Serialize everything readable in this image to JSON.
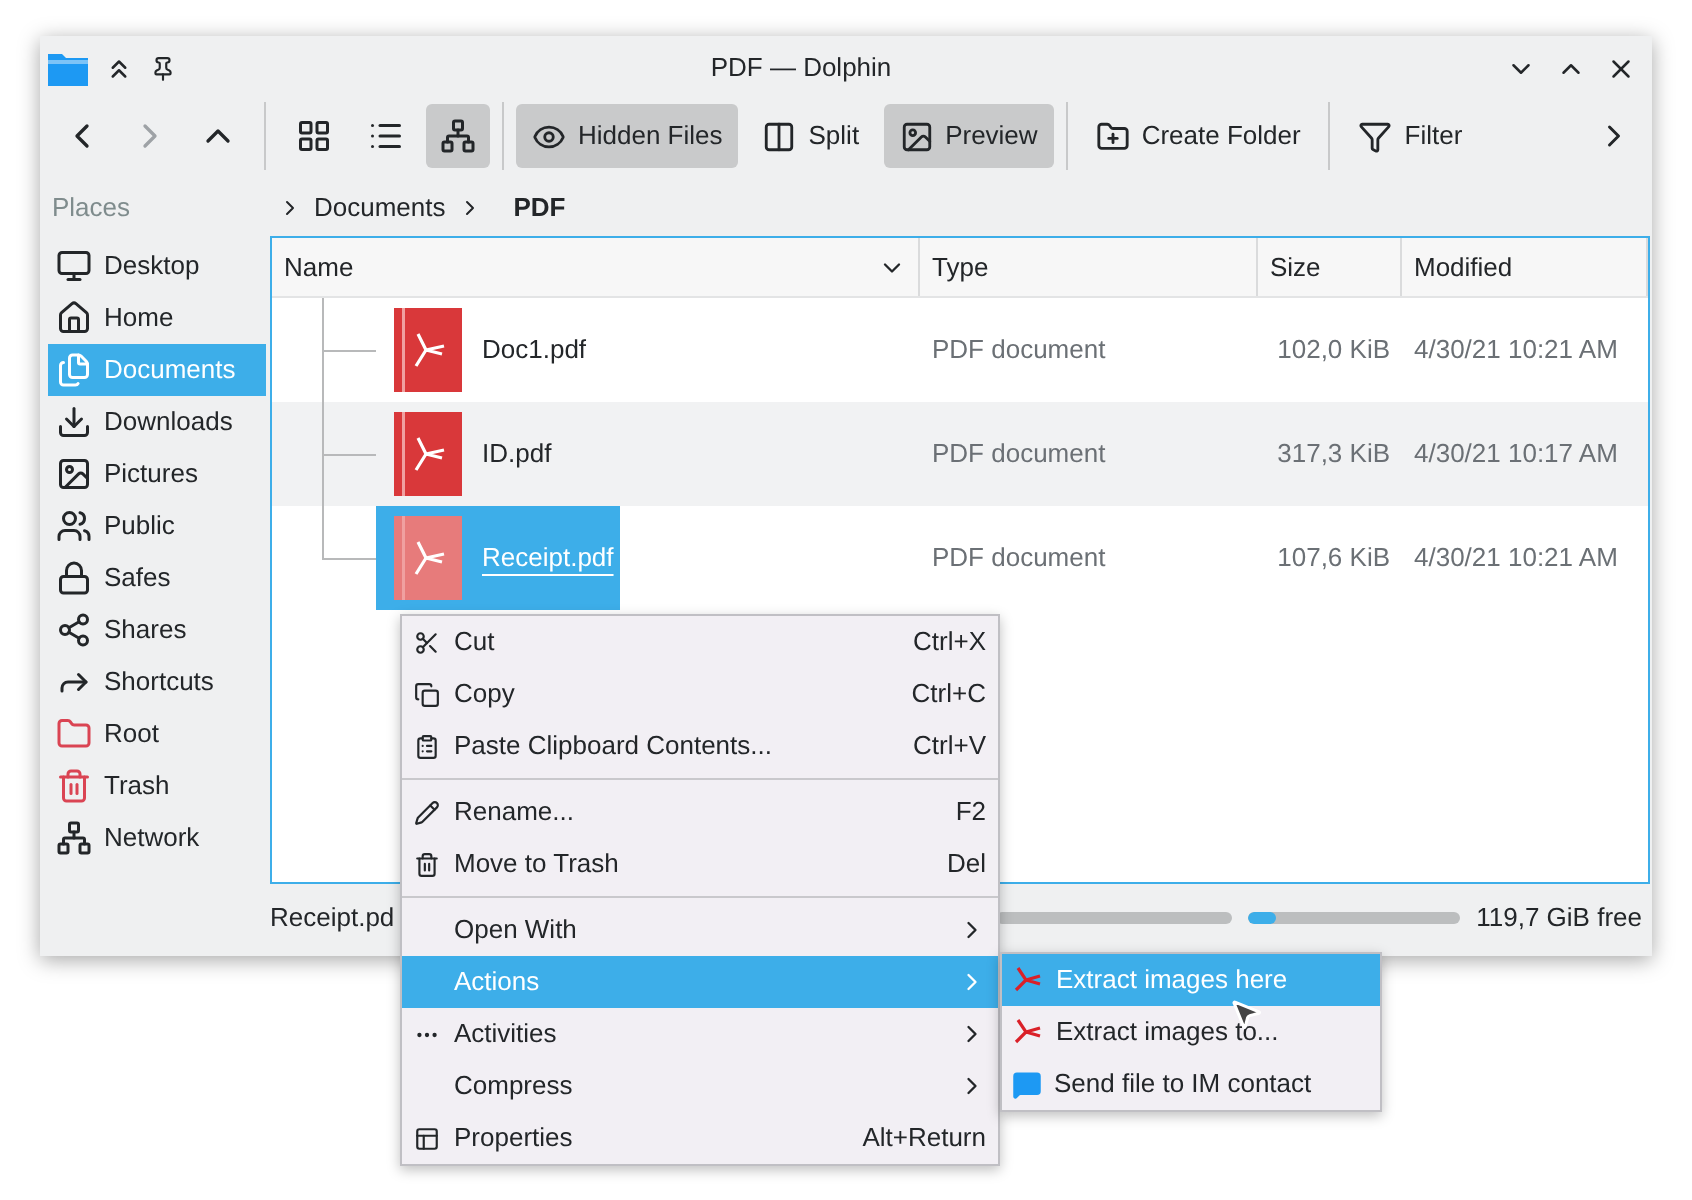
{
  "window": {
    "title": "PDF — Dolphin"
  },
  "toolbar": {
    "view_modes": [
      {
        "kind": "icons",
        "selected": false
      },
      {
        "kind": "compact",
        "selected": false
      },
      {
        "kind": "details",
        "selected": true
      }
    ],
    "buttons": [
      {
        "kind": "hidden",
        "label": "Hidden Files",
        "selected": true
      },
      {
        "kind": "split",
        "label": "Split",
        "selected": false
      },
      {
        "kind": "preview",
        "label": "Preview",
        "selected": true
      },
      {
        "kind": "create",
        "label": "Create Folder",
        "selected": false
      },
      {
        "kind": "filter",
        "label": "Filter",
        "selected": false
      }
    ]
  },
  "places": {
    "header": "Places",
    "items": [
      {
        "kind": "desktop",
        "label": "Desktop",
        "selected": false
      },
      {
        "kind": "home",
        "label": "Home",
        "selected": false
      },
      {
        "kind": "documents",
        "label": "Documents",
        "selected": true
      },
      {
        "kind": "downloads",
        "label": "Downloads",
        "selected": false
      },
      {
        "kind": "pictures",
        "label": "Pictures",
        "selected": false
      },
      {
        "kind": "public",
        "label": "Public",
        "selected": false
      },
      {
        "kind": "safes",
        "label": "Safes",
        "selected": false
      },
      {
        "kind": "shares",
        "label": "Shares",
        "selected": false
      },
      {
        "kind": "shortcuts",
        "label": "Shortcuts",
        "selected": false
      },
      {
        "kind": "root",
        "label": "Root",
        "selected": false
      },
      {
        "kind": "trash",
        "label": "Trash",
        "selected": false
      },
      {
        "kind": "network",
        "label": "Network",
        "selected": false
      }
    ]
  },
  "breadcrumb": [
    "Documents",
    "PDF"
  ],
  "table": {
    "columns": [
      "Name",
      "Type",
      "Size",
      "Modified"
    ],
    "rows": [
      {
        "name": "Doc1.pdf",
        "type": "PDF document",
        "size": "102,0 KiB",
        "modified": "4/30/21 10:21 AM",
        "selected": false
      },
      {
        "name": "ID.pdf",
        "type": "PDF document",
        "size": "317,3 KiB",
        "modified": "4/30/21 10:17 AM",
        "selected": false
      },
      {
        "name": "Receipt.pdf",
        "type": "PDF document",
        "size": "107,6 KiB",
        "modified": "4/30/21 10:21 AM",
        "selected": true
      }
    ]
  },
  "status_bar": {
    "text": "Receipt.pd",
    "free_space": {
      "level": 0.13,
      "reading": "119,7 GiB free"
    }
  },
  "context_menu": {
    "items": [
      {
        "kind": "cut",
        "label": "Cut",
        "shortcut": "Ctrl+X",
        "submenu": false,
        "selected": false
      },
      {
        "kind": "copy",
        "label": "Copy",
        "shortcut": "Ctrl+C",
        "submenu": false,
        "selected": false
      },
      {
        "kind": "paste",
        "label": "Paste Clipboard Contents...",
        "shortcut": "Ctrl+V",
        "submenu": false,
        "selected": false
      },
      {
        "kind": "separator"
      },
      {
        "kind": "rename",
        "label": "Rename...",
        "shortcut": "F2",
        "submenu": false,
        "selected": false
      },
      {
        "kind": "trash",
        "label": "Move to Trash",
        "shortcut": "Del",
        "submenu": false,
        "selected": false
      },
      {
        "kind": "separator"
      },
      {
        "kind": "plain",
        "label": "Open With",
        "submenu": true,
        "selected": false
      },
      {
        "kind": "plain",
        "label": "Actions",
        "submenu": true,
        "selected": true
      },
      {
        "kind": "activities",
        "label": "Activities",
        "submenu": true,
        "selected": false
      },
      {
        "kind": "plain",
        "label": "Compress",
        "submenu": true,
        "selected": false
      },
      {
        "kind": "properties",
        "label": "Properties",
        "shortcut": "Alt+Return",
        "submenu": false,
        "selected": false
      }
    ]
  },
  "submenu": {
    "items": [
      {
        "kind": "pdf",
        "label": "Extract images here",
        "selected": true
      },
      {
        "kind": "pdf",
        "label": "Extract images to...",
        "selected": false
      },
      {
        "kind": "chat",
        "label": "Send file to IM contact",
        "selected": false
      }
    ]
  }
}
